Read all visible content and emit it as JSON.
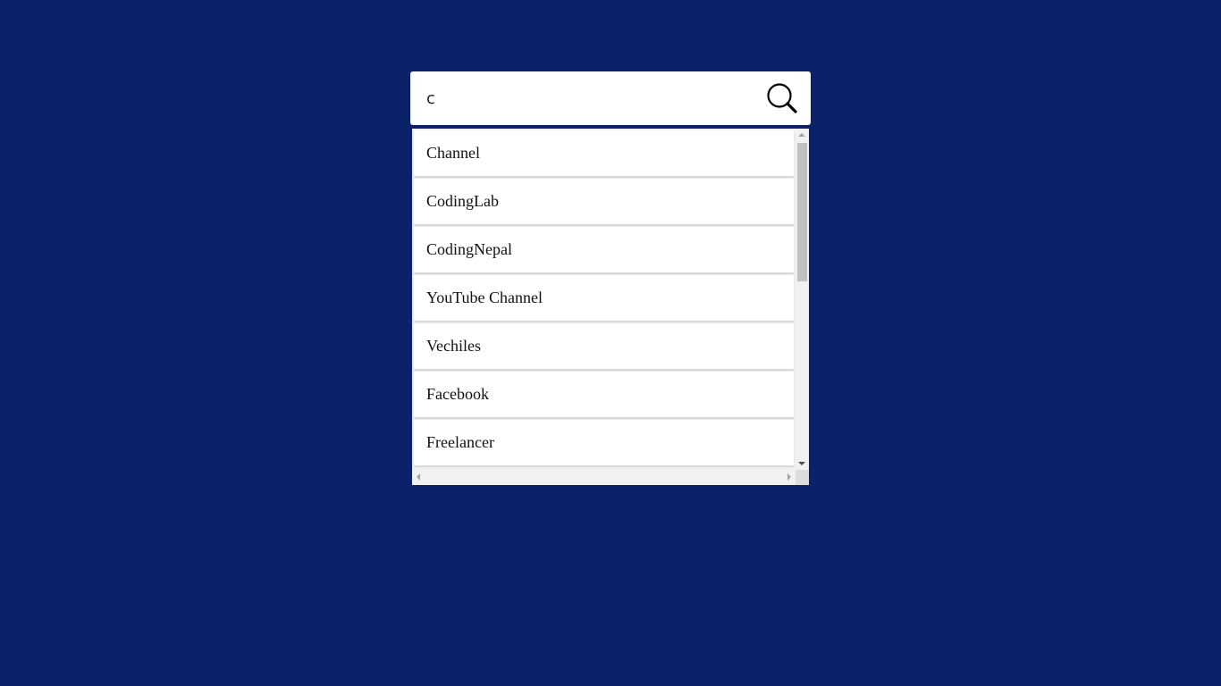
{
  "colors": {
    "page_background": "#0b216a",
    "panel_background": "#ffffff",
    "scroll_track": "#f1f1f1",
    "scroll_thumb": "#c1c1c1"
  },
  "search": {
    "value": "c",
    "placeholder": "",
    "icon": "search-icon"
  },
  "suggestions": {
    "items": [
      {
        "label": "Channel"
      },
      {
        "label": "CodingLab"
      },
      {
        "label": "CodingNepal"
      },
      {
        "label": "YouTube Channel"
      },
      {
        "label": "Vechiles"
      },
      {
        "label": "Facebook"
      },
      {
        "label": "Freelancer"
      }
    ]
  }
}
